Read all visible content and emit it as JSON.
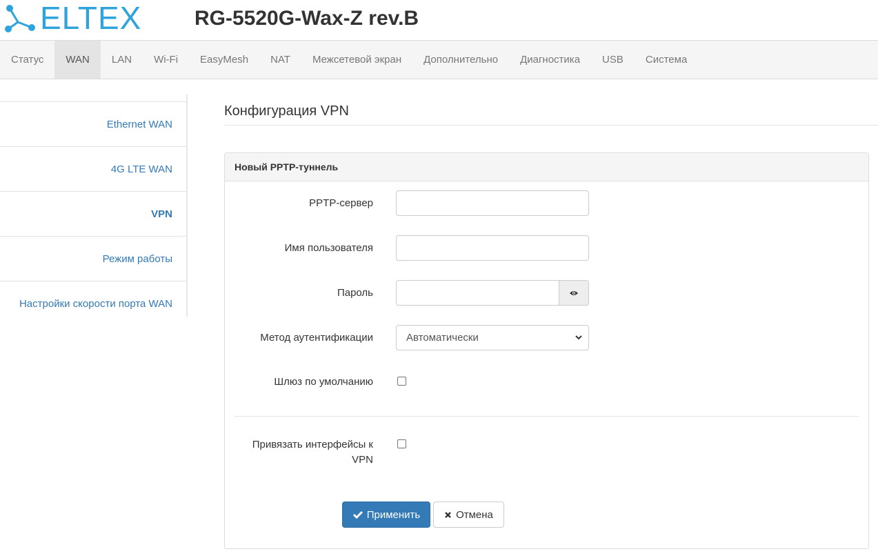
{
  "brand": {
    "logo_text": "ELTEX",
    "device_title": "RG-5520G-Wax-Z rev.B",
    "logo_color": "#2ea3dc"
  },
  "nav": {
    "items": [
      {
        "label": "Статус"
      },
      {
        "label": "WAN"
      },
      {
        "label": "LAN"
      },
      {
        "label": "Wi-Fi"
      },
      {
        "label": "EasyMesh"
      },
      {
        "label": "NAT"
      },
      {
        "label": "Межсетевой экран"
      },
      {
        "label": "Дополнительно"
      },
      {
        "label": "Диагностика"
      },
      {
        "label": "USB"
      },
      {
        "label": "Система"
      }
    ],
    "active": "WAN"
  },
  "sidebar": {
    "items": [
      {
        "label": "Ethernet WAN"
      },
      {
        "label": "4G LTE WAN"
      },
      {
        "label": "VPN"
      },
      {
        "label": "Режим работы"
      },
      {
        "label": "Настройки скорости порта WAN"
      }
    ],
    "active": "VPN"
  },
  "main": {
    "page_title": "Конфигурация VPN",
    "panel_title": "Новый PPTP-туннель",
    "form": {
      "server_label": "PPTP-сервер",
      "server_value": "",
      "username_label": "Имя пользователя",
      "username_value": "",
      "password_label": "Пароль",
      "password_value": "",
      "auth_label": "Метод аутентификации",
      "auth_value": "Автоматически",
      "gateway_label": "Шлюз по умолчанию",
      "gateway_checked": false,
      "bind_label": "Привязать интерфейсы к VPN",
      "bind_checked": false
    },
    "buttons": {
      "apply_label": "Применить",
      "cancel_label": "Отмена"
    }
  },
  "colors": {
    "link": "#337ab7",
    "primary_button": "#337ab7",
    "nav_bg": "#f5f5f5",
    "nav_active_bg": "#e4e4e4"
  },
  "icons": [
    "eltex-logo-icon",
    "eye-icon",
    "chevron-down-icon",
    "check-icon",
    "close-icon"
  ]
}
